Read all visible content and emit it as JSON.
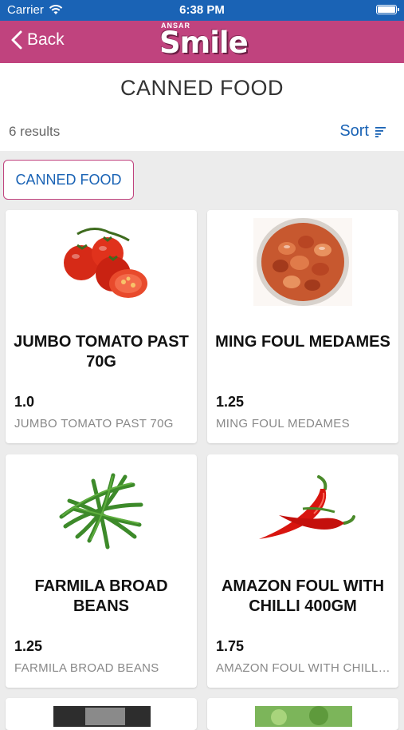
{
  "status": {
    "carrier": "Carrier",
    "time": "6:38 PM"
  },
  "nav": {
    "back_label": "Back",
    "logo_small": "ANSAR",
    "logo_big": "Smile"
  },
  "page": {
    "title": "CANNED FOOD",
    "results": "6 results",
    "sort_label": "Sort"
  },
  "filter_chip": "CANNED FOOD",
  "products": [
    {
      "name": "JUMBO TOMATO PAST 70G",
      "price": "1.0",
      "subtitle": "JUMBO TOMATO PAST 70G",
      "image": "tomato-image"
    },
    {
      "name": "MING FOUL MEDAMES",
      "price": "1.25",
      "subtitle": "MING FOUL MEDAMES",
      "image": "foul-medames-image"
    },
    {
      "name": "FARMILA BROAD BEANS",
      "price": "1.25",
      "subtitle": "FARMILA BROAD BEANS",
      "image": "green-beans-image"
    },
    {
      "name": "AMAZON FOUL WITH CHILLI 400GM",
      "price": "1.75",
      "subtitle": "AMAZON FOUL WITH CHILLI 400GM",
      "image": "chilli-image"
    }
  ],
  "colors": {
    "status_bar": "#1a63b5",
    "nav_bar": "#c0437e",
    "link": "#1a63b5"
  }
}
